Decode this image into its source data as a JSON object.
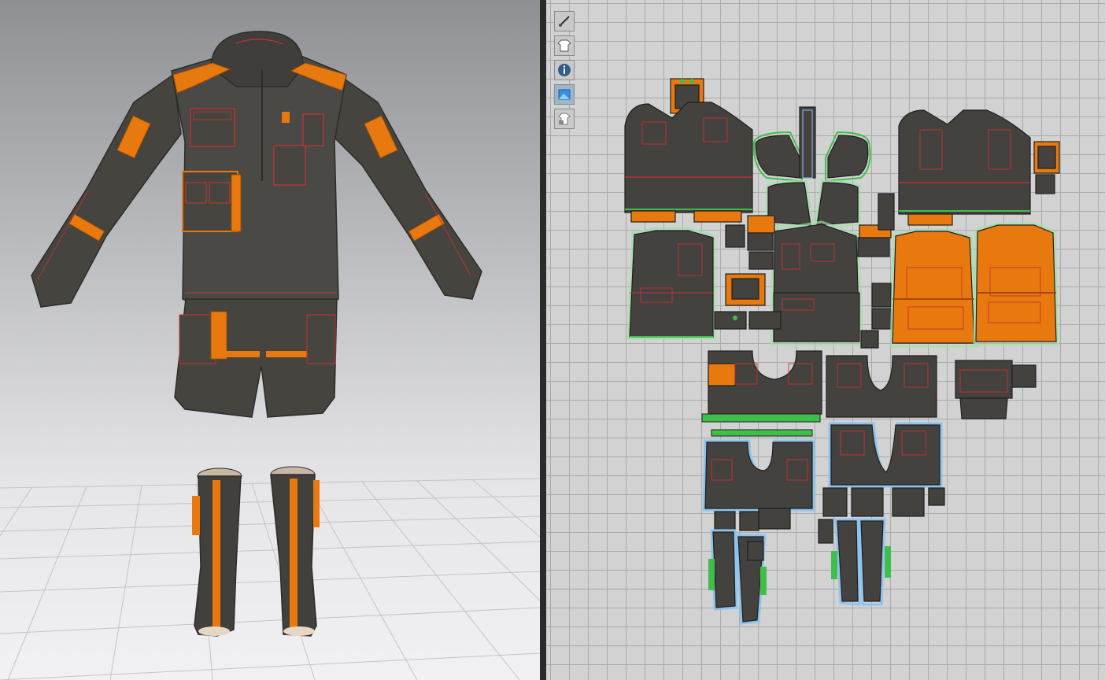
{
  "app": {
    "panes": [
      "3d-garment-view",
      "2d-pattern-view"
    ]
  },
  "colors": {
    "fabric_main": "#43423f",
    "accent_orange": "#e8790f",
    "stitch_red": "#c83232",
    "selected_green": "#3fbf4a",
    "selected_blue": "#8ec3ee",
    "grid_bg": "#d2d2d2",
    "viewport_top": "#8f9094",
    "viewport_floor": "#eeeeef"
  },
  "toolbar_2d": {
    "tools": [
      {
        "name": "brush-visibility-icon"
      },
      {
        "name": "garment-visibility-icon"
      },
      {
        "name": "info-visibility-icon"
      },
      {
        "name": "texture-visibility-icon"
      },
      {
        "name": "garment-lock-icon"
      }
    ]
  },
  "garment_3d": {
    "items": [
      "jacket",
      "shorts",
      "left-boot",
      "right-boot"
    ]
  }
}
